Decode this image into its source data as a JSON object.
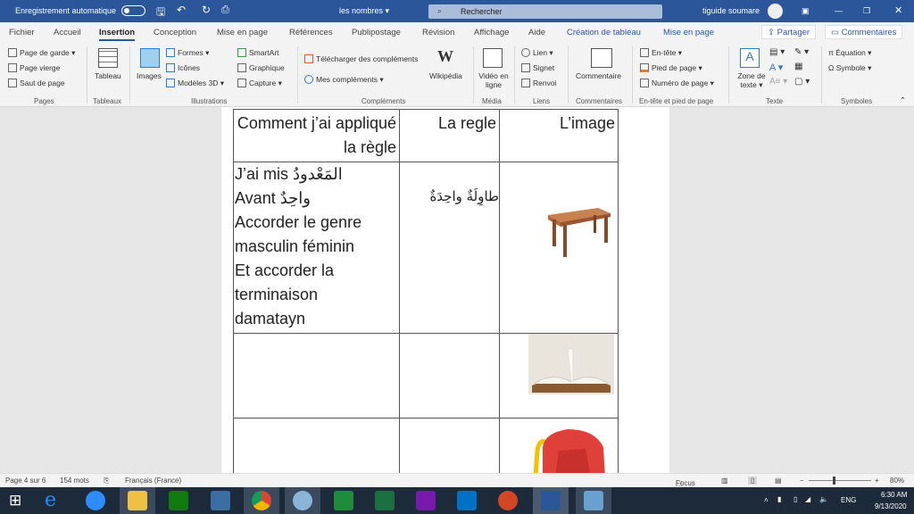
{
  "titlebar": {
    "autosave": "Enregistrement automatique",
    "doc_title": "les nombres ▾",
    "search_placeholder": "Rechercher",
    "user": "tiguide soumare"
  },
  "tabs": [
    "Fichier",
    "Accueil",
    "Insertion",
    "Conception",
    "Mise en page",
    "Références",
    "Publipostage",
    "Révision",
    "Affichage",
    "Aide",
    "Création de tableau",
    "Mise en page"
  ],
  "share": "Partager",
  "comments": "Commentaires",
  "ribbon": {
    "pages": [
      "Page de garde ▾",
      "Page vierge",
      "Saut de page"
    ],
    "tableau": "Tableau",
    "images": "Images",
    "illus": [
      "Formes ▾",
      "Icônes",
      "Modèles 3D ▾",
      "SmartArt",
      "Graphique",
      "Capture ▾"
    ],
    "complements": [
      "Télécharger des compléments",
      "Mes compléments ▾"
    ],
    "wikipedia": "Wikipédia",
    "video": "Vidéo en ligne",
    "liens": [
      "Lien ▾",
      "Signet",
      "Renvoi"
    ],
    "commentaire": "Commentaire",
    "entete": [
      "En-tête ▾",
      "Pied de page ▾",
      "Numéro de page ▾"
    ],
    "zone": "Zone de texte ▾",
    "symboles": [
      "Équation ▾",
      "Symbole ▾"
    ],
    "groups": [
      "Pages",
      "Tableaux",
      "Illustrations",
      "Compléments",
      "Média",
      "Liens",
      "Commentaires",
      "En-tête et pied de page",
      "Texte",
      "Symboles"
    ]
  },
  "table": {
    "headers": [
      "Comment j’ai appliqué la règle",
      "La regle",
      "L’image"
    ],
    "row1": {
      "how_lines": [
        "J’ai mis المَعْدودُ",
        "Avant واحِدٌ",
        "Accorder le genre",
        "masculin féminin",
        "Et accorder la",
        "terminaison",
        "damatayn"
      ],
      "rule": "طاوِلَةٌ واحِدَةٌ"
    }
  },
  "status": {
    "page": "Page 4 sur 6",
    "words": "154 mots",
    "lang": "Français (France)",
    "focus": "Focus",
    "zoom": "80%",
    "zoom_value": 80
  },
  "tray": {
    "lang": "ENG",
    "time": "6:30 AM",
    "date": "9/13/2020"
  }
}
